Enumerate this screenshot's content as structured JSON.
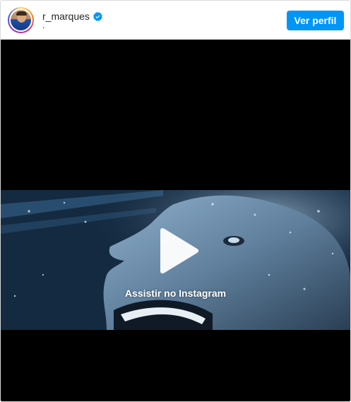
{
  "header": {
    "username": "r_marques",
    "subtitle": ".",
    "verified_icon": "verified-badge-icon",
    "view_profile_label": "Ver perfil"
  },
  "media": {
    "play_icon": "play-icon",
    "watch_label": "Assistir no Instagram"
  },
  "colors": {
    "accent": "#0095f6",
    "border": "#dbdbdb",
    "media_background": "#000000",
    "text": "#262626"
  }
}
